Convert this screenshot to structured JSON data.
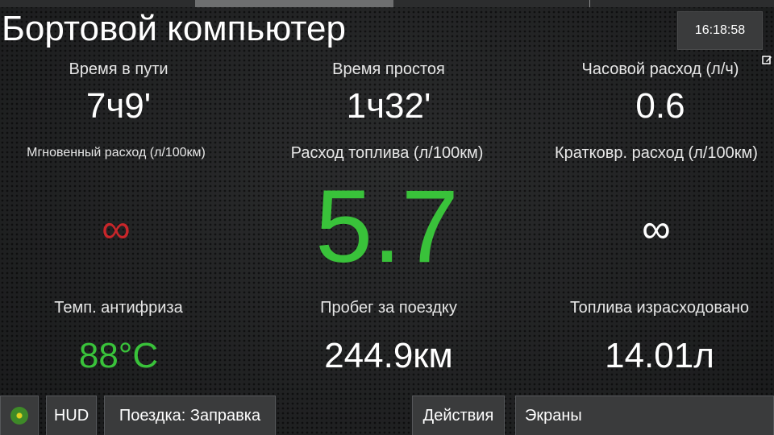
{
  "header": {
    "title": "Бортовой компьютер",
    "clock": "16:18:58"
  },
  "icons": {
    "edit": "edit-icon",
    "status": "status-dot-icon"
  },
  "colors": {
    "accent_green": "#39c23a",
    "alert_red": "#c8262a",
    "text": "#ffffff"
  },
  "metrics": {
    "travel_time": {
      "label": "Время в пути",
      "value": "7ч9'"
    },
    "idle_time": {
      "label": "Время простоя",
      "value": "1ч32'"
    },
    "hourly_consumption": {
      "label": "Часовой расход (л/ч)",
      "value": "0.6"
    },
    "instant_consumption": {
      "label": "Мгновенный расход (л/100км)",
      "value": "∞"
    },
    "fuel_consumption": {
      "label": "Расход топлива (л/100км)",
      "value": "5.7"
    },
    "short_consumption": {
      "label": "Кратковр. расход (л/100км)",
      "value": "∞"
    },
    "coolant_temp": {
      "label": "Темп. антифриза",
      "value": "88°C"
    },
    "trip_distance": {
      "label": "Пробег за поездку",
      "value": "244.9км"
    },
    "fuel_used": {
      "label": "Топлива израсходовано",
      "value": "14.01л"
    }
  },
  "toolbar": {
    "hud": "HUD",
    "trip": "Поездка: Заправка",
    "actions": "Действия",
    "screens": "Экраны"
  }
}
